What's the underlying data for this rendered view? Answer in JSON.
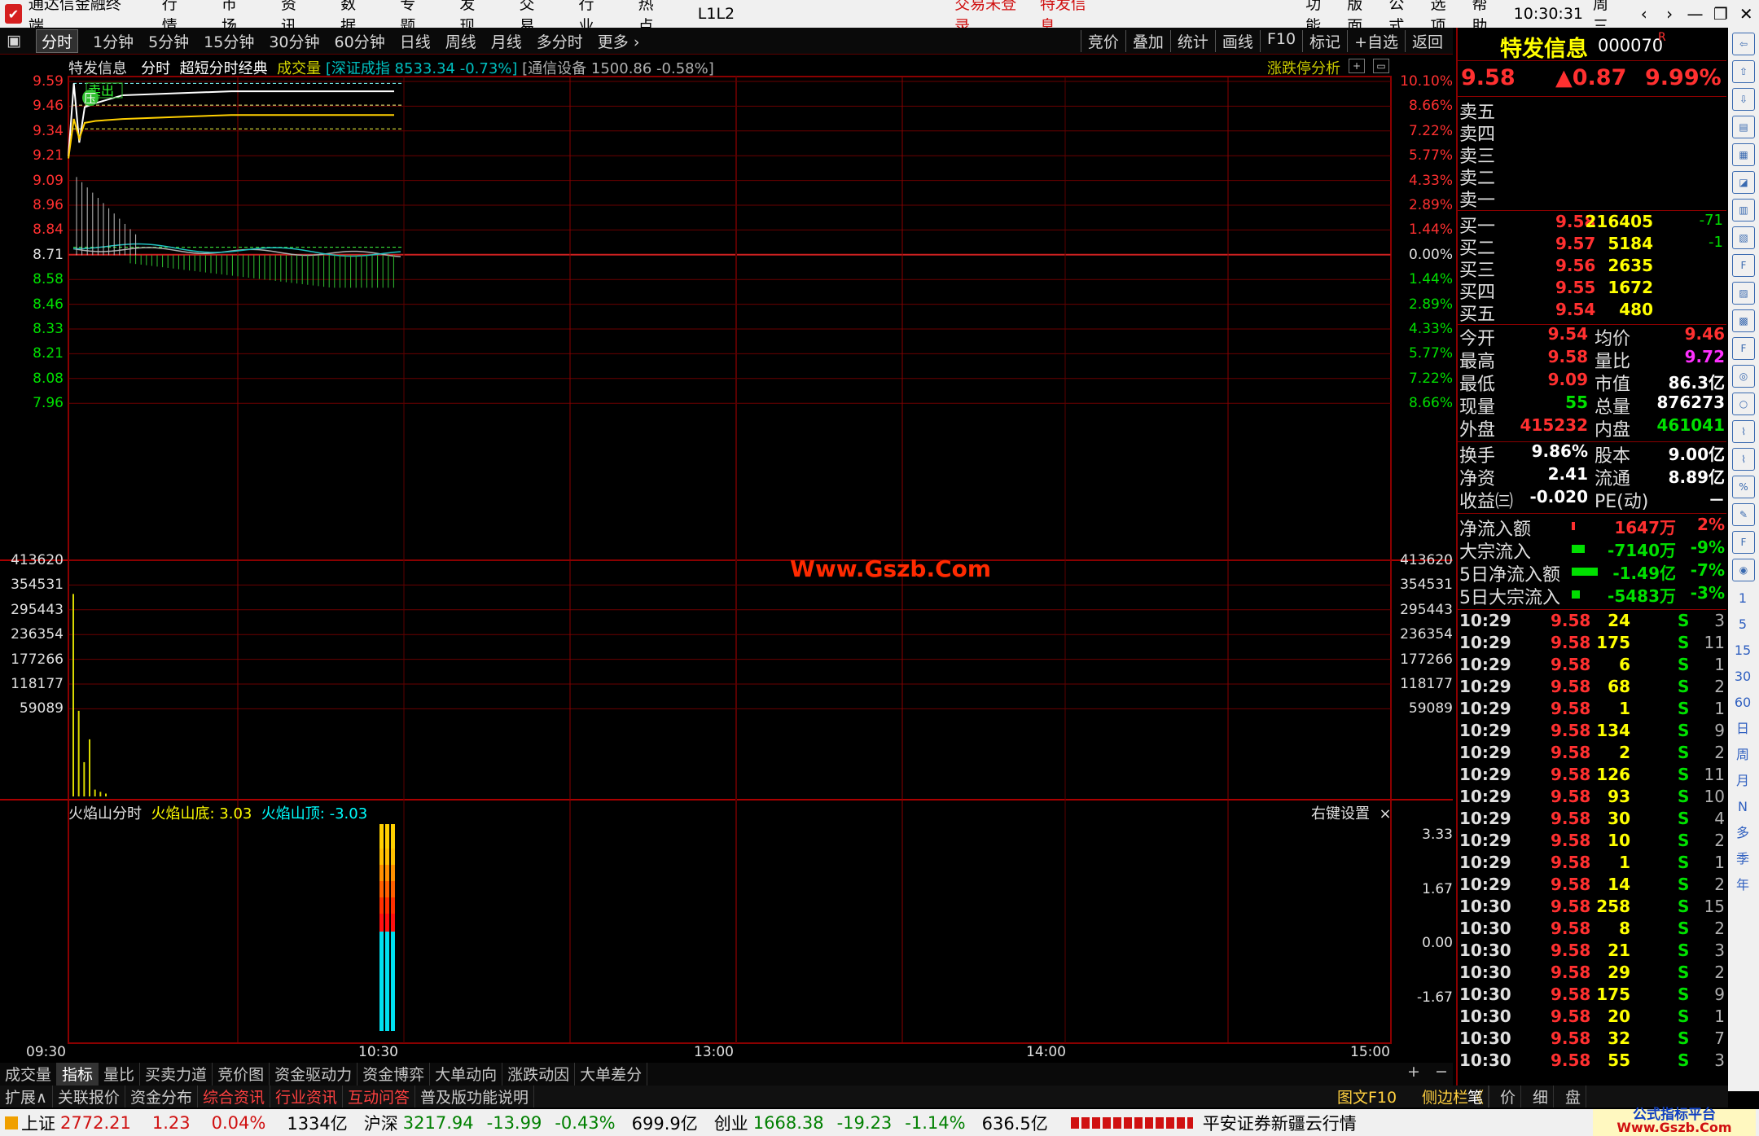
{
  "app": {
    "title": "通达信金融终端",
    "menu": [
      "行情",
      "市场",
      "资讯",
      "数据",
      "专题",
      "发现",
      "交易",
      "行业",
      "热点",
      "L1L2"
    ],
    "notice_login": "交易未登录",
    "notice_stock": "特发信息",
    "right_menu": [
      "功能",
      "版面",
      "公式",
      "选项",
      "帮助"
    ],
    "time": "10:30:31",
    "weekday": "周三"
  },
  "tabs": {
    "periods": [
      "分时",
      "1分钟",
      "5分钟",
      "15分钟",
      "30分钟",
      "60分钟",
      "日线",
      "周线",
      "月线",
      "多分时",
      "更多 ›"
    ],
    "active": "分时",
    "right": [
      "竞价",
      "叠加",
      "统计",
      "画线",
      "F10",
      "标记",
      "+自选",
      "返回"
    ]
  },
  "chart_header": {
    "name": "特发信息",
    "mode": "分时",
    "style": "超短分时经典",
    "vol_label": "成交量",
    "index1": "[深证成指 8533.34 -0.73%]",
    "index2": "[通信设备 1500.86 -0.58%]",
    "limit_analysis": "涨跌停分析",
    "sell_tag": "卖出",
    "press_tag": "压"
  },
  "price_axis_left": [
    "9.59",
    "9.46",
    "9.34",
    "9.21",
    "9.09",
    "8.96",
    "8.84",
    "8.71",
    "8.58",
    "8.46",
    "8.33",
    "8.21",
    "8.08",
    "7.96"
  ],
  "price_axis_right": [
    "10.10%",
    "8.66%",
    "7.22%",
    "5.77%",
    "4.33%",
    "2.89%",
    "1.44%",
    "0.00%",
    "1.44%",
    "2.89%",
    "4.33%",
    "5.77%",
    "7.22%",
    "8.66%"
  ],
  "vol_axis": [
    "413620",
    "354531",
    "295443",
    "236354",
    "177266",
    "118177",
    "59089"
  ],
  "watermark": "Www.Gszb.Com",
  "indicator": {
    "name": "火焰山分时",
    "l1_label": "火焰山底:",
    "l1_value": "3.03",
    "l2_label": "火焰山顶:",
    "l2_value": "-3.03",
    "settings": "右键设置",
    "axis": [
      "3.33",
      "1.67",
      "0.00",
      "-1.67"
    ]
  },
  "time_axis": [
    "09:30",
    "10:30",
    "13:00",
    "14:00",
    "15:00"
  ],
  "chart_data": {
    "type": "line",
    "x": [
      "09:30",
      "09:31",
      "09:32",
      "09:33",
      "09:35",
      "09:40",
      "09:50",
      "10:00",
      "10:10",
      "10:20",
      "10:30"
    ],
    "series": [
      {
        "values": [
          9.21,
          9.58,
          9.28,
          9.46,
          9.48,
          9.52,
          9.53,
          9.54,
          9.54,
          9.54,
          9.54
        ]
      },
      {
        "values": [
          9.2,
          9.4,
          9.3,
          9.38,
          9.39,
          9.4,
          9.41,
          9.42,
          9.42,
          9.42,
          9.42
        ]
      }
    ],
    "ylim": [
      7.96,
      9.59
    ],
    "volume_x": [
      "09:30",
      "09:31",
      "09:32",
      "09:33",
      "09:34",
      "09:35",
      "09:36"
    ],
    "volume": [
      354531,
      150000,
      60000,
      100000,
      12000,
      8000,
      5000
    ]
  },
  "quote": {
    "name": "特发信息",
    "code": "000070",
    "flag": "R",
    "price": "9.58",
    "change": "▲0.87",
    "pct": "9.99%",
    "asks": [
      {
        "label": "卖五"
      },
      {
        "label": "卖四"
      },
      {
        "label": "卖三"
      },
      {
        "label": "卖二"
      },
      {
        "label": "卖一"
      }
    ],
    "bids": [
      {
        "label": "买一",
        "price": "9.58",
        "vol": "216405",
        "chg": "-71"
      },
      {
        "label": "买二",
        "price": "9.57",
        "vol": "5184",
        "chg": "-1"
      },
      {
        "label": "买三",
        "price": "9.56",
        "vol": "2635",
        "chg": ""
      },
      {
        "label": "买四",
        "price": "9.55",
        "vol": "1672",
        "chg": ""
      },
      {
        "label": "买五",
        "price": "9.54",
        "vol": "480",
        "chg": ""
      }
    ],
    "stats1": [
      {
        "l1": "今开",
        "v1": "9.54",
        "l2": "均价",
        "v2": "9.46"
      },
      {
        "l1": "最高",
        "v1": "9.58",
        "l2": "量比",
        "v2": "9.72"
      },
      {
        "l1": "最低",
        "v1": "9.09",
        "l2": "市值",
        "v2": "86.3亿"
      },
      {
        "l1": "现量",
        "v1": "55",
        "l2": "总量",
        "v2": "876273"
      },
      {
        "l1": "外盘",
        "v1": "415232",
        "l2": "内盘",
        "v2": "461041"
      }
    ],
    "stats2": [
      {
        "l1": "换手",
        "v1": "9.86%",
        "l2": "股本",
        "v2": "9.00亿"
      },
      {
        "l1": "净资",
        "v1": "2.41",
        "l2": "流通",
        "v2": "8.89亿"
      },
      {
        "l1": "收益㈢",
        "v1": "-0.020",
        "l2": "PE(动)",
        "v2": "－"
      }
    ],
    "flows": [
      {
        "label": "净流入额",
        "value": "1647万",
        "pct": "2%"
      },
      {
        "label": "大宗流入",
        "value": "-7140万",
        "pct": "-9%"
      },
      {
        "label": "5日净流入额",
        "value": "-1.49亿",
        "pct": "-7%"
      },
      {
        "label": "5日大宗流入",
        "value": "-5483万",
        "pct": "-3%"
      }
    ],
    "ticks": [
      {
        "t": "10:29",
        "p": "9.58",
        "v": "24",
        "s": "S",
        "n": "3"
      },
      {
        "t": "10:29",
        "p": "9.58",
        "v": "175",
        "s": "S",
        "n": "11"
      },
      {
        "t": "10:29",
        "p": "9.58",
        "v": "6",
        "s": "S",
        "n": "1"
      },
      {
        "t": "10:29",
        "p": "9.58",
        "v": "68",
        "s": "S",
        "n": "2"
      },
      {
        "t": "10:29",
        "p": "9.58",
        "v": "1",
        "s": "S",
        "n": "1"
      },
      {
        "t": "10:29",
        "p": "9.58",
        "v": "134",
        "s": "S",
        "n": "9"
      },
      {
        "t": "10:29",
        "p": "9.58",
        "v": "2",
        "s": "S",
        "n": "2"
      },
      {
        "t": "10:29",
        "p": "9.58",
        "v": "126",
        "s": "S",
        "n": "11"
      },
      {
        "t": "10:29",
        "p": "9.58",
        "v": "93",
        "s": "S",
        "n": "10"
      },
      {
        "t": "10:29",
        "p": "9.58",
        "v": "30",
        "s": "S",
        "n": "4"
      },
      {
        "t": "10:29",
        "p": "9.58",
        "v": "10",
        "s": "S",
        "n": "2"
      },
      {
        "t": "10:29",
        "p": "9.58",
        "v": "1",
        "s": "S",
        "n": "1"
      },
      {
        "t": "10:29",
        "p": "9.58",
        "v": "14",
        "s": "S",
        "n": "2"
      },
      {
        "t": "10:30",
        "p": "9.58",
        "v": "258",
        "s": "S",
        "n": "15"
      },
      {
        "t": "10:30",
        "p": "9.58",
        "v": "8",
        "s": "S",
        "n": "2"
      },
      {
        "t": "10:30",
        "p": "9.58",
        "v": "21",
        "s": "S",
        "n": "3"
      },
      {
        "t": "10:30",
        "p": "9.58",
        "v": "29",
        "s": "S",
        "n": "2"
      },
      {
        "t": "10:30",
        "p": "9.58",
        "v": "175",
        "s": "S",
        "n": "9"
      },
      {
        "t": "10:30",
        "p": "9.58",
        "v": "20",
        "s": "S",
        "n": "1"
      },
      {
        "t": "10:30",
        "p": "9.58",
        "v": "32",
        "s": "S",
        "n": "7"
      },
      {
        "t": "10:30",
        "p": "9.58",
        "v": "55",
        "s": "S",
        "n": "3"
      }
    ]
  },
  "toolstrip": [
    "1",
    "5",
    "15",
    "30",
    "60",
    "日",
    "周",
    "月",
    "N",
    "多",
    "季",
    "年"
  ],
  "bottom_tabs": [
    "成交量",
    "指标",
    "量比",
    "买卖力道",
    "竞价图",
    "资金驱动力",
    "资金博弈",
    "大单动向",
    "涨跌动因",
    "大单差分"
  ],
  "bottom_tabs2": [
    "扩展∧",
    "关联报价",
    "资金分布",
    "综合资讯",
    "行业资讯",
    "互动问答",
    "普及版功能说明"
  ],
  "bottom_right": [
    "图文F10",
    "侧边栏《",
    "笔",
    "价",
    "细",
    "盘"
  ],
  "status": {
    "sh_label": "上证",
    "sh_val": "2772.21",
    "sh_chg": "1.23",
    "sh_pct": "0.04%",
    "sh_amt": "1334亿",
    "hs_label": "沪深",
    "hs_val": "3217.94",
    "hs_chg": "-13.99",
    "hs_pct": "-0.43%",
    "hs_amt": "699.9亿",
    "cy_label": "创业",
    "cy_val": "1668.38",
    "cy_chg": "-19.23",
    "cy_pct": "-1.14%",
    "cy_amt": "636.5亿",
    "broker": "平安证券新疆云行情",
    "site_title": "公式指标平台",
    "site_url": "Www.Gszb.Com"
  }
}
